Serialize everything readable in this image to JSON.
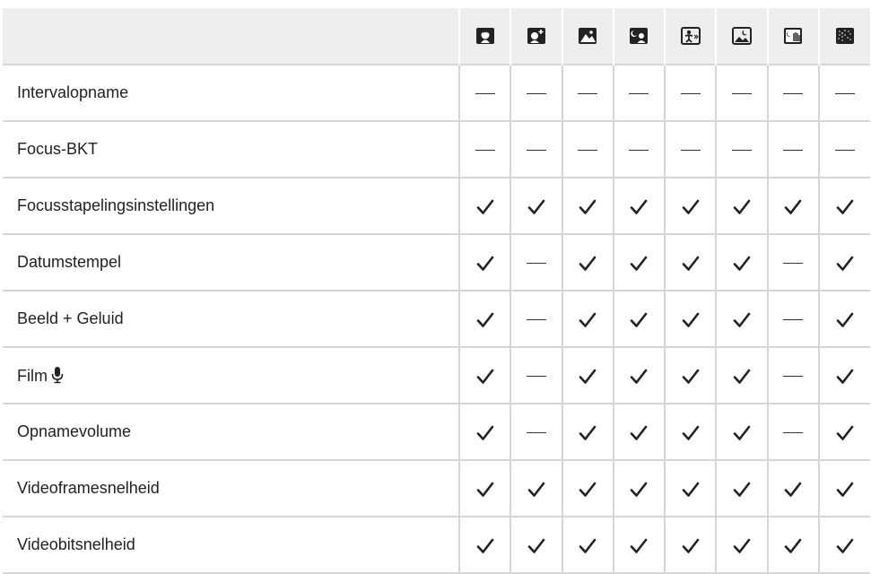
{
  "header": {
    "mode_icons": [
      "portrait-mode-icon",
      "e-portrait-mode-icon",
      "landscape-mode-icon",
      "night-portrait-mode-icon",
      "children-mode-icon",
      "night-scene-mode-icon",
      "hand-held-starlight-mode-icon",
      "fireworks-mode-icon"
    ]
  },
  "rows": [
    {
      "label": "Intervalopname",
      "values": [
        "—",
        "—",
        "—",
        "—",
        "—",
        "—",
        "—",
        "—"
      ]
    },
    {
      "label": "Focus-BKT",
      "values": [
        "—",
        "—",
        "—",
        "—",
        "—",
        "—",
        "—",
        "—"
      ]
    },
    {
      "label": "Focusstapelingsinstellingen",
      "values": [
        "✓",
        "✓",
        "✓",
        "✓",
        "✓",
        "✓",
        "✓",
        "✓"
      ]
    },
    {
      "label": "Datumstempel",
      "values": [
        "✓",
        "—",
        "✓",
        "✓",
        "✓",
        "✓",
        "—",
        "✓"
      ]
    },
    {
      "label": "Beeld + Geluid",
      "values": [
        "✓",
        "—",
        "✓",
        "✓",
        "✓",
        "✓",
        "—",
        "✓"
      ]
    },
    {
      "label": "Film",
      "label_icon": "microphone-icon",
      "values": [
        "✓",
        "—",
        "✓",
        "✓",
        "✓",
        "✓",
        "—",
        "✓"
      ]
    },
    {
      "label": "Opnamevolume",
      "values": [
        "✓",
        "—",
        "✓",
        "✓",
        "✓",
        "✓",
        "—",
        "✓"
      ]
    },
    {
      "label": "Videoframesnelheid",
      "values": [
        "✓",
        "✓",
        "✓",
        "✓",
        "✓",
        "✓",
        "✓",
        "✓"
      ]
    },
    {
      "label": "Videobitsnelheid",
      "values": [
        "✓",
        "✓",
        "✓",
        "✓",
        "✓",
        "✓",
        "✓",
        "✓"
      ]
    }
  ]
}
